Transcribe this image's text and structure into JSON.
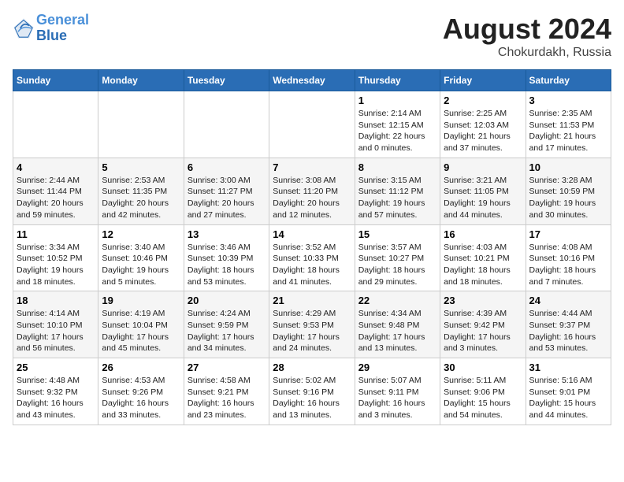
{
  "header": {
    "logo_line1": "General",
    "logo_line2": "Blue",
    "month_year": "August 2024",
    "location": "Chokurdakh, Russia"
  },
  "weekdays": [
    "Sunday",
    "Monday",
    "Tuesday",
    "Wednesday",
    "Thursday",
    "Friday",
    "Saturday"
  ],
  "weeks": [
    [
      {
        "day": "",
        "info": ""
      },
      {
        "day": "",
        "info": ""
      },
      {
        "day": "",
        "info": ""
      },
      {
        "day": "",
        "info": ""
      },
      {
        "day": "1",
        "info": "Sunrise: 2:14 AM\nSunset: 12:15 AM\nDaylight: 22 hours\nand 0 minutes."
      },
      {
        "day": "2",
        "info": "Sunrise: 2:25 AM\nSunset: 12:03 AM\nDaylight: 21 hours\nand 37 minutes."
      },
      {
        "day": "3",
        "info": "Sunrise: 2:35 AM\nSunset: 11:53 PM\nDaylight: 21 hours\nand 17 minutes."
      }
    ],
    [
      {
        "day": "4",
        "info": "Sunrise: 2:44 AM\nSunset: 11:44 PM\nDaylight: 20 hours\nand 59 minutes."
      },
      {
        "day": "5",
        "info": "Sunrise: 2:53 AM\nSunset: 11:35 PM\nDaylight: 20 hours\nand 42 minutes."
      },
      {
        "day": "6",
        "info": "Sunrise: 3:00 AM\nSunset: 11:27 PM\nDaylight: 20 hours\nand 27 minutes."
      },
      {
        "day": "7",
        "info": "Sunrise: 3:08 AM\nSunset: 11:20 PM\nDaylight: 20 hours\nand 12 minutes."
      },
      {
        "day": "8",
        "info": "Sunrise: 3:15 AM\nSunset: 11:12 PM\nDaylight: 19 hours\nand 57 minutes."
      },
      {
        "day": "9",
        "info": "Sunrise: 3:21 AM\nSunset: 11:05 PM\nDaylight: 19 hours\nand 44 minutes."
      },
      {
        "day": "10",
        "info": "Sunrise: 3:28 AM\nSunset: 10:59 PM\nDaylight: 19 hours\nand 30 minutes."
      }
    ],
    [
      {
        "day": "11",
        "info": "Sunrise: 3:34 AM\nSunset: 10:52 PM\nDaylight: 19 hours\nand 18 minutes."
      },
      {
        "day": "12",
        "info": "Sunrise: 3:40 AM\nSunset: 10:46 PM\nDaylight: 19 hours\nand 5 minutes."
      },
      {
        "day": "13",
        "info": "Sunrise: 3:46 AM\nSunset: 10:39 PM\nDaylight: 18 hours\nand 53 minutes."
      },
      {
        "day": "14",
        "info": "Sunrise: 3:52 AM\nSunset: 10:33 PM\nDaylight: 18 hours\nand 41 minutes."
      },
      {
        "day": "15",
        "info": "Sunrise: 3:57 AM\nSunset: 10:27 PM\nDaylight: 18 hours\nand 29 minutes."
      },
      {
        "day": "16",
        "info": "Sunrise: 4:03 AM\nSunset: 10:21 PM\nDaylight: 18 hours\nand 18 minutes."
      },
      {
        "day": "17",
        "info": "Sunrise: 4:08 AM\nSunset: 10:16 PM\nDaylight: 18 hours\nand 7 minutes."
      }
    ],
    [
      {
        "day": "18",
        "info": "Sunrise: 4:14 AM\nSunset: 10:10 PM\nDaylight: 17 hours\nand 56 minutes."
      },
      {
        "day": "19",
        "info": "Sunrise: 4:19 AM\nSunset: 10:04 PM\nDaylight: 17 hours\nand 45 minutes."
      },
      {
        "day": "20",
        "info": "Sunrise: 4:24 AM\nSunset: 9:59 PM\nDaylight: 17 hours\nand 34 minutes."
      },
      {
        "day": "21",
        "info": "Sunrise: 4:29 AM\nSunset: 9:53 PM\nDaylight: 17 hours\nand 24 minutes."
      },
      {
        "day": "22",
        "info": "Sunrise: 4:34 AM\nSunset: 9:48 PM\nDaylight: 17 hours\nand 13 minutes."
      },
      {
        "day": "23",
        "info": "Sunrise: 4:39 AM\nSunset: 9:42 PM\nDaylight: 17 hours\nand 3 minutes."
      },
      {
        "day": "24",
        "info": "Sunrise: 4:44 AM\nSunset: 9:37 PM\nDaylight: 16 hours\nand 53 minutes."
      }
    ],
    [
      {
        "day": "25",
        "info": "Sunrise: 4:48 AM\nSunset: 9:32 PM\nDaylight: 16 hours\nand 43 minutes."
      },
      {
        "day": "26",
        "info": "Sunrise: 4:53 AM\nSunset: 9:26 PM\nDaylight: 16 hours\nand 33 minutes."
      },
      {
        "day": "27",
        "info": "Sunrise: 4:58 AM\nSunset: 9:21 PM\nDaylight: 16 hours\nand 23 minutes."
      },
      {
        "day": "28",
        "info": "Sunrise: 5:02 AM\nSunset: 9:16 PM\nDaylight: 16 hours\nand 13 minutes."
      },
      {
        "day": "29",
        "info": "Sunrise: 5:07 AM\nSunset: 9:11 PM\nDaylight: 16 hours\nand 3 minutes."
      },
      {
        "day": "30",
        "info": "Sunrise: 5:11 AM\nSunset: 9:06 PM\nDaylight: 15 hours\nand 54 minutes."
      },
      {
        "day": "31",
        "info": "Sunrise: 5:16 AM\nSunset: 9:01 PM\nDaylight: 15 hours\nand 44 minutes."
      }
    ]
  ]
}
